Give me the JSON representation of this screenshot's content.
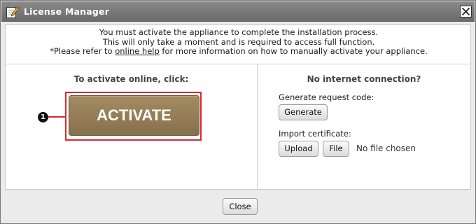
{
  "window": {
    "title": "License Manager",
    "title_icon": "edit-pencil-icon",
    "close_icon": "close-icon"
  },
  "intro": {
    "line1": "You must activate the appliance to complete the installation process.",
    "line2": "This will only take a moment and is required to access full function.",
    "line3_before": "*Please refer to ",
    "line3_link": "online help",
    "line3_after": " for more information on how to manually activate your appliance."
  },
  "online": {
    "heading": "To activate online, click:",
    "activate_label": "ACTIVATE",
    "callout_number": "1",
    "callout_color": "#e0262f",
    "button_color": "#9a8259"
  },
  "offline": {
    "heading": "No internet connection?",
    "request_label": "Generate request code:",
    "generate_label": "Generate",
    "import_label": "Import certificate:",
    "upload_label": "Upload",
    "file_label": "File",
    "file_status": "No file chosen"
  },
  "footer": {
    "close_label": "Close"
  }
}
